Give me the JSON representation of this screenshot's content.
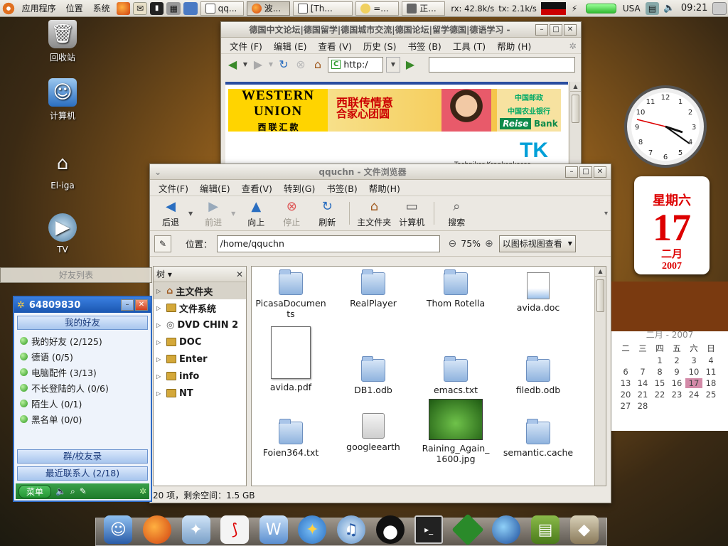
{
  "top_panel": {
    "menus": [
      "应用程序",
      "位置",
      "系统"
    ],
    "tasks": [
      "qq...",
      "波...",
      "[Th...",
      "=...",
      "正..."
    ],
    "net_rx": "rx: 42.8k/s",
    "net_tx": "tx: 2.1k/s",
    "keyboard_layout": "USA",
    "clock": "09:21"
  },
  "desktop_icons": [
    {
      "label": "回收站",
      "icon": "trash-icon"
    },
    {
      "label": "计算机",
      "icon": "computer-icon"
    },
    {
      "label": "El-iga",
      "icon": "home-icon"
    },
    {
      "label": "TV",
      "icon": "tv-icon"
    }
  ],
  "browser": {
    "title": "德国中文论坛|德国留学|德国城市交流|德国论坛|留学德国|德语学习 -",
    "menus": [
      "文件 (F)",
      "编辑 (E)",
      "查看 (V)",
      "历史 (S)",
      "书签 (B)",
      "工具 (T)",
      "帮助 (H)"
    ],
    "url": "http:/",
    "banner": {
      "wu_line1": "WESTERN",
      "wu_line2": "UNION",
      "wu_cn": "西 联 汇 款",
      "slogan1": "西联传情意",
      "slogan2": "合家心团圆",
      "post": "中国邮政",
      "bank_cn": "中国农业银行",
      "reise": "Reise",
      "bank": "Bank"
    },
    "tk_logo": "TK",
    "tk_text": "Techniker Krankenkasse"
  },
  "file_manager": {
    "title": "qquchn - 文件浏览器",
    "menus": [
      "文件(F)",
      "编辑(E)",
      "查看(V)",
      "转到(G)",
      "书签(B)",
      "帮助(H)"
    ],
    "toolbar": {
      "back": "后退",
      "forward": "前进",
      "up": "向上",
      "stop": "停止",
      "refresh": "刷新",
      "home": "主文件夹",
      "computer": "计算机",
      "search": "搜索"
    },
    "location_label": "位置：",
    "location": "/home/qquchn",
    "zoom": "75%",
    "view_mode": "以图标视图查看",
    "sidebar_mode": "树",
    "tree": [
      "主文件夹",
      "文件系统",
      "DVD CHIN 2",
      "DOC",
      "Enter",
      "info",
      "NT"
    ],
    "files": [
      {
        "name": "PicasaDocumen ts",
        "kind": "folder"
      },
      {
        "name": "RealPlayer",
        "kind": "folder"
      },
      {
        "name": "Thom Rotella",
        "kind": "folder"
      },
      {
        "name": "avida.doc",
        "kind": "doc"
      },
      {
        "name": "avida.pdf",
        "kind": "pdf"
      },
      {
        "name": "DB1.odb",
        "kind": "folder"
      },
      {
        "name": "emacs.txt",
        "kind": "folder"
      },
      {
        "name": "filedb.odb",
        "kind": "folder"
      },
      {
        "name": "Foien364.txt",
        "kind": "folder"
      },
      {
        "name": "googleearth",
        "kind": "exec"
      },
      {
        "name": "Raining_Again_ 1600.jpg",
        "kind": "image"
      },
      {
        "name": "semantic.cache",
        "kind": "folder"
      }
    ],
    "status": "20 项，剩余空间：1.5 GB"
  },
  "calendar_widget": {
    "weekday": "星期六",
    "day": "17",
    "month": "二月",
    "year": "2007"
  },
  "month_calendar": {
    "header": "二月 - 2007",
    "weekdays": [
      "二",
      "三",
      "四",
      "五",
      "六",
      "日"
    ],
    "rows": [
      [
        "",
        "",
        "1",
        "2",
        "3",
        "4"
      ],
      [
        "6",
        "7",
        "8",
        "9",
        "10",
        "11"
      ],
      [
        "13",
        "14",
        "15",
        "16",
        "17",
        "18"
      ],
      [
        "20",
        "21",
        "22",
        "23",
        "24",
        "25"
      ],
      [
        "27",
        "28",
        "",
        "",
        "",
        ""
      ]
    ]
  },
  "qq": {
    "strip_title": "好友列表",
    "number": "64809830",
    "tab_friends": "我的好友",
    "groups": [
      "我的好友 (2/125)",
      "德语 (0/5)",
      "电脑配件 (3/13)",
      "不长登陆的人 (0/6)",
      "陌生人 (0/1)",
      "黑名单 (0/0)"
    ],
    "tab_groups": "群/校友录",
    "tab_recent": "最近联系人 (2/18)",
    "menu": "菜单"
  },
  "dock": [
    "finder-icon",
    "firefox-icon",
    "bird-icon",
    "pdf-icon",
    "word-icon",
    "aim-icon",
    "itunes-icon",
    "qq-penguin-icon",
    "terminal-icon",
    "vim-icon",
    "earth-icon",
    "books-icon",
    "gimp-icon"
  ],
  "colors": {
    "accent": "#2f6bc4",
    "calendar_red": "#dd0000"
  }
}
